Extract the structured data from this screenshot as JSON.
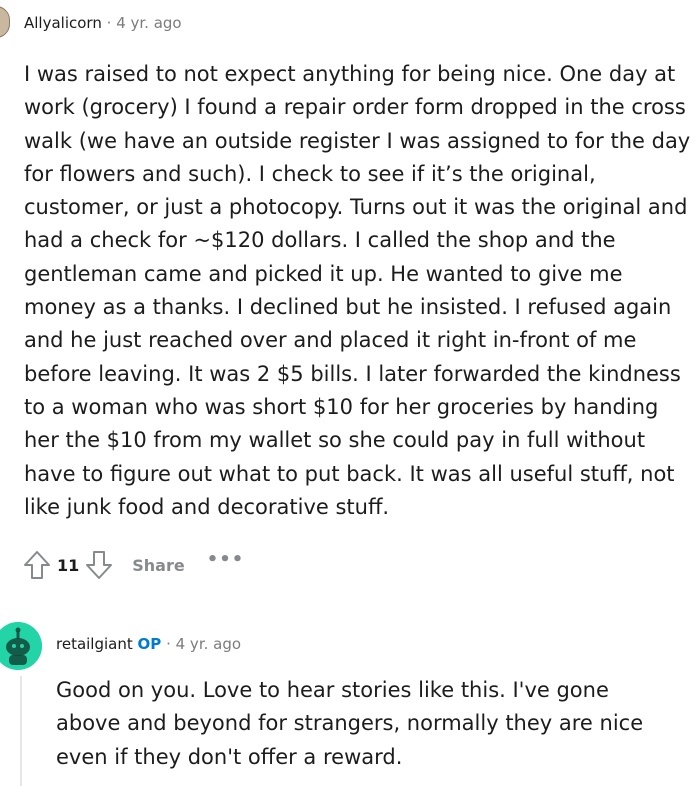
{
  "comment": {
    "author": "Allyalicorn",
    "separator": "·",
    "time": "4 yr. ago",
    "body": "I was raised to not expect anything for being nice. One day at work (grocery) I found a repair order form dropped in the cross walk (we have an outside register I was assigned to for the day for flowers and such). I check to see if it’s the original, customer, or just a photocopy. Turns out it was the original and had a check for ~$120 dollars. I called the shop and the gentleman came and picked it up. He wanted to give me money as a thanks. I declined but he insisted. I refused again and he just reached over and placed it right in-front of me before leaving. It was 2 $5 bills. I later forwarded the kindness to a woman who was short $10 for her groceries by handing her the $10 from my wallet so she could pay in full without have to figure out what to put back. It was all useful stuff, not like junk food and decorative stuff.",
    "score": "11",
    "share_label": "Share",
    "more_label": "•••"
  },
  "reply": {
    "author": "retailgiant",
    "op_badge": "OP",
    "separator": "·",
    "time": "4 yr. ago",
    "body": "Good on you. Love to hear stories like this. I've gone above and beyond for strangers, normally they are nice even if they don't offer a reward."
  },
  "icons": {
    "upvote": "upvote-arrow-icon",
    "downvote": "downvote-arrow-icon",
    "more": "more-options-icon",
    "avatar": "snoo-avatar-icon"
  },
  "colors": {
    "op_badge": "#0079d3",
    "muted": "#878a8c",
    "avatar_bg": "#23d5a6"
  }
}
